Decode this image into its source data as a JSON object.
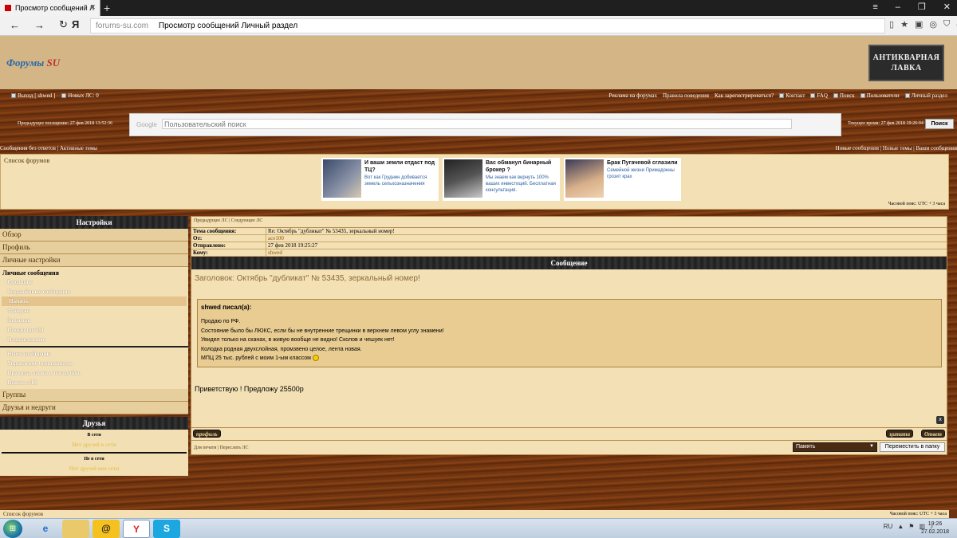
{
  "browser": {
    "tab_title": "Просмотр сообщений Л",
    "new_tab": "+",
    "domain": "forums-su.com",
    "page_title": "Просмотр сообщений Личный раздел",
    "yandex": "Я"
  },
  "header": {
    "logo_main": "Форумы ",
    "logo_su": "SU",
    "shop_line1": "АНТИКВАРНАЯ",
    "shop_line2": "ЛАВКА"
  },
  "topnav": {
    "logout": "Выход [ shwed ]",
    "new_pm": "Новых ЛС: 0",
    "ads": "Реклама на форумах",
    "rules": "Правила поведения",
    "howreg": "Как зарегистрироваться?",
    "contact": "Контакт",
    "faq": "FAQ",
    "search": "Поиск",
    "users": "Пользователи",
    "private": "Личный раздел"
  },
  "times": {
    "prev_visit": "Предыдущее посещение: 27 фев 2018 13:52:36",
    "current": "Текущее время: 27 фев 2018 19:26:04"
  },
  "gsearch": {
    "brand": "Google",
    "placeholder": "Пользовательский поиск",
    "button": "Поиск",
    "clear": "×"
  },
  "links2": {
    "left": "Сообщения без ответов | Активные темы",
    "right": "Новые сообщения | Новые темы | Ваши сообщения"
  },
  "adpanel": {
    "forumlist": "Список форумов",
    "timezone": "Часовой пояс: UTC + 3 часа",
    "ads": [
      {
        "title": "И ваши земли отдаст под ТЦ?",
        "desc": "Вот как Груднин добивается земель сельхозназначения"
      },
      {
        "title": "Вас обманул бинарный брокер ?",
        "desc": "Мы знаем как вернуть 100% ваших инвестиций. Бесплатная консультация."
      },
      {
        "title": "Брак Пугачевой сглазили",
        "desc": "Семейной жизни Примадонны грозит крах"
      }
    ]
  },
  "sidebar": {
    "settings_head": "Настройки",
    "overview": "Обзор",
    "profile": "Профиль",
    "personal": "Личные настройки",
    "pm": "Личные сообщения",
    "inbox": "Входящие",
    "saved": "Сохранённые сообщения",
    "memory": "Память",
    "faberge": "Фаберже",
    "spare": "Запасная",
    "outbox": "Исходящие (5)",
    "sent": "Отправленные",
    "new_msg": "Новое сообщение",
    "drafts": "Управление черновиками",
    "rules": "Правила, папки и настройки",
    "search_pm": "Поиск в ЛС",
    "groups": "Группы",
    "friends_foes": "Друзья и недруги",
    "friends_head": "Друзья",
    "online": "В сети",
    "no_online": "Нет друзей в сети",
    "offline": "Не в сети",
    "no_offline": "Нет друзей вне сети"
  },
  "message": {
    "nav": "Предыдущее ЛС | Следующее ЛС",
    "subject_label": "Тема сообщения:",
    "subject": "Re: Октябрь \"дубликат\" № 53435, зеркальный номер!",
    "from_label": "От:",
    "from": "ace100",
    "sent_label": "Отправлено:",
    "sent": "27 фев 2018 19:25:27",
    "to_label": "Кому:",
    "to": "shwed",
    "head": "Сообщение",
    "title": "Заголовок: Октябрь \"дубликат\" № 53435, зеркальный номер!",
    "quote_author": "shwed писал(а):",
    "quote_lines": [
      "Продаю по РФ.",
      "Состояние было бы ЛЮКС, если бы не внутренние трещинки в верхнем левом углу знамени!",
      "Увидел только на сканах, в живую вообще не видно! Сколов и чешуек нет!",
      "Колодка родная двухслойная, промзвено целое, лента новая.",
      "МПЦ 25 тыс. рублей с моим 1-ым классом"
    ],
    "reply": "Приветствую ! Предложу 25500р",
    "close": "x",
    "btn_profile": "профиль",
    "btn_quote": "цитата",
    "btn_reply": "Ответ",
    "footer_links": "Для печати | Переслать ЛС",
    "folder": "Память",
    "move": "Переместить в папку"
  },
  "bottom": {
    "forumlist": "Список форумов",
    "timezone": "Часовой пояс: UTC + 3 часа"
  },
  "taskbar": {
    "lang": "RU",
    "time": "19:26",
    "date": "27.02.2018"
  }
}
